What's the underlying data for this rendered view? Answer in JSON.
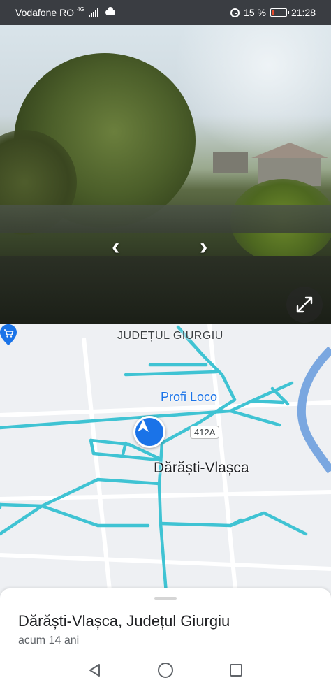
{
  "status_bar": {
    "carrier": "Vodafone RO",
    "network": "4G",
    "battery_percent": "15 %",
    "time": "21:28",
    "battery_level": 0.15,
    "battery_color": "#e54d2e"
  },
  "street_view": {
    "prev_icon": "chevron-left-icon",
    "next_icon": "chevron-right-icon",
    "expand_icon": "expand-diagonal-icon"
  },
  "map": {
    "county_label": "JUDEȚUL GIURGIU",
    "poi_label": "Profi Loco",
    "poi_icon": "shopping-cart-pin-icon",
    "road_number": "412A",
    "village_label": "Dărăști-Vlașca",
    "coverage_color": "#3fc3d3",
    "marker_color": "#1a73e8"
  },
  "place": {
    "title": "Dărăști-Vlașca, Județul Giurgiu",
    "date": "acum 14 ani"
  },
  "nav": {
    "back_icon": "triangle-back-icon",
    "home_icon": "circle-home-icon",
    "recents_icon": "square-recents-icon"
  }
}
